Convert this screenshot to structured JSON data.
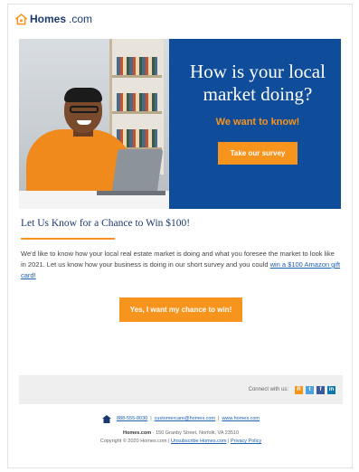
{
  "header": {
    "logo_bold": "Homes",
    "logo_light": ".com"
  },
  "hero": {
    "title": "How is your local market doing?",
    "subtitle": "We want to know!",
    "button_label": "Take our survey"
  },
  "content": {
    "headline": "Let Us Know for a Chance to Win $100!",
    "body_plain": "We'd like to know how your local real estate market is doing and what you foresee the market to look like in 2021. Let us know how your business is doing in our short survey and you could ",
    "body_link": "win a $100 Amazon gift card!",
    "cta_label": "Yes, I want my chance to win!"
  },
  "footer": {
    "share_label": "Connect with us:",
    "social": [
      {
        "icon": "rss-icon",
        "glyph": "R",
        "color": "#f7941d"
      },
      {
        "icon": "twitter-icon",
        "glyph": "t",
        "color": "#4aa3df"
      },
      {
        "icon": "facebook-icon",
        "glyph": "f",
        "color": "#3b5998"
      },
      {
        "icon": "linkedin-icon",
        "glyph": "in",
        "color": "#0e76a8"
      }
    ],
    "phone": "888-555-8030",
    "email": "customercare@homes.com",
    "website": "www.homes.com",
    "company": "Homes.com",
    "address": "150 Granby Street, Norfolk, VA 23510",
    "copyright": "Copyright © 2020 Homes.com",
    "unsubscribe": "Unsubscribe Homes.com",
    "privacy": "Privacy Policy"
  },
  "colors": {
    "brand_blue": "#0f4d9a",
    "accent_orange": "#f7941d",
    "navy": "#1a3a6e"
  }
}
